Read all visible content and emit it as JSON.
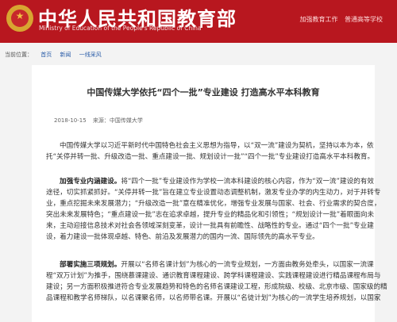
{
  "header": {
    "title_cn": "中华人民共和国教育部",
    "title_en": "Ministry of Education of the People's Republic of China",
    "links": [
      "加强教育工作",
      "普通高等学校"
    ]
  },
  "breadcrumb": [
    "当前位置：",
    "首页",
    "新闻",
    "一线采风"
  ],
  "article": {
    "title": "中国传媒大学依托“四个一批”专业建设 打造高水平本科教育",
    "date": "2018-10-15",
    "source": "来源：中国传媒大学",
    "p1": [
      "中国传媒大学以习近平新时代中国特色社会主义思想为指导，以“双一流”建设为契机，坚持以本为本，依",
      "托“关停并转一批、升级改造一批、重点建设一批、规划设计一批”“四个一批”专业建设打造高水平本科教育。"
    ],
    "p2_lead": "加强专业内涵建设。",
    "p2": [
      "将“四个一批”专业建设作为学校一流本科建设的核心内容，作为“双一流”建设的有效",
      "途径，切实抓紧抓好。“关停并转一批”旨在建立专业设置动态调整机制，激发专业办学的内生动力，对于并转专",
      "业，重点挖掘未来发展潜力；“升级改造一批”意在精准优化，增强专业发展与国家、社会、行业需求的契合度，",
      "突出未来发展特色；“重点建设一批”志在追求卓越，提升专业的精品化和引领性；“规划设计一批”着眼面向未",
      "来，主动迎接信息技术对社会各领域深刻变革，设计一批具有前瞻性、战略性的专业。通过“四个一批”专业建",
      "设，着力建设一批体现卓越、特色、前沿及发展潜力的国内一流、国际领先的高水平专业。"
    ],
    "p3_lead": "部署实施三项规划。",
    "p3": [
      "开展以“名师名课计划”为核心的一流专业规划，一方面由教务处牵头，以国家一流课",
      "程“双万计划”为推手，围绕慕课建设、通识教育课程建设、跨学科课程建设、实践课程建设进行精品课程布局与",
      "建设；另一方面积极推进符合专业发展趋势和特色的名师名课建设工程，形成院级、校级、北京市级、国家级的精",
      "品课程和教学名师梯队，以名课聚名师，以名师带名课。开展以“名徒计划”为核心的一流学生培养规划，以国家"
    ]
  }
}
